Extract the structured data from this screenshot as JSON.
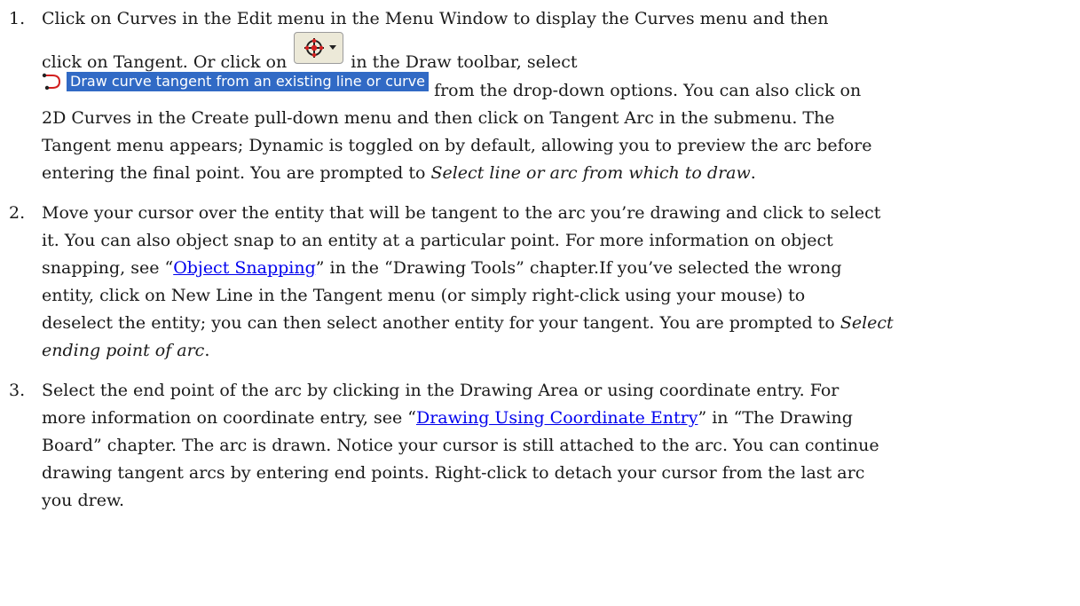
{
  "steps": [
    {
      "number": "1.",
      "line1": "Click on Curves in the Edit menu in the Menu Window to display the Curves menu and then",
      "line2a": "click on Tangent. Or click on",
      "line2b": "in the Draw toolbar, select",
      "dropdown_option": "Draw curve tangent from an existing line or curve",
      "line3b": "from the drop-down options. You can also click on",
      "line4": "2D Curves in the Create pull-down menu and then click on Tangent Arc in the submenu. The",
      "line5": "Tangent menu appears; Dynamic is toggled on by default, allowing you to preview the arc before",
      "line6a": "entering the final point. You are prompted to ",
      "line6em": "Select line or arc from which to draw",
      "line6b": "."
    },
    {
      "number": "2.",
      "line1": "Move your cursor over the entity that will be tangent to the arc you’re drawing and click to select",
      "line2": "it. You can also object snap to an entity at a particular point. For more information on object",
      "line3a": "snapping, see “",
      "link": "Object Snapping",
      "line3b": "” in the “Drawing Tools” chapter.If you’ve selected the wrong",
      "line4": "entity, click on New Line in the Tangent menu (or simply right-click using your mouse) to",
      "line5a": "deselect the entity; you can then select another entity for your tangent. You are prompted to ",
      "line5em": "Select",
      "line6em": "ending point of arc",
      "line6b": "."
    },
    {
      "number": "3.",
      "line1": "Select the end point of the arc by clicking in the Drawing Area or using coordinate entry. For",
      "line2a": "more information on coordinate entry, see “",
      "link": "Drawing Using Coordinate Entry",
      "line2b": "” in “The Drawing",
      "line3": "Board” chapter. The arc is drawn. Notice your cursor is still attached to the arc. You can continue",
      "line4": "drawing tangent arcs by entering end points. Right-click to detach your cursor from the last arc",
      "line5": "you drew."
    }
  ],
  "icons": {
    "toolbar_button": "curve-draw-icon",
    "dropdown_option": "tangent-arc-icon"
  },
  "colors": {
    "link": "#0000ee",
    "option_highlight": "#316ac5"
  }
}
